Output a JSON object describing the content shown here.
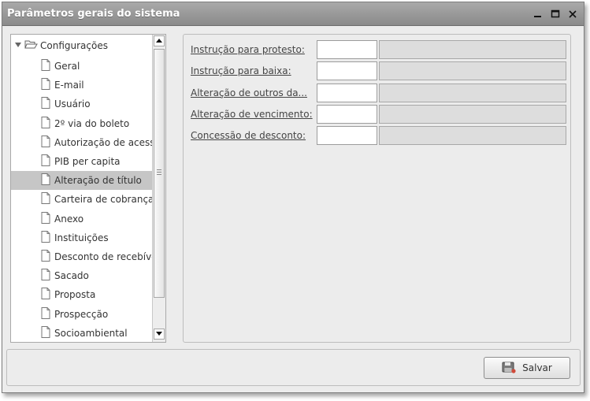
{
  "window": {
    "title": "Parâmetros gerais do sistema",
    "controls": [
      "minimize-icon",
      "maximize-icon",
      "close-icon"
    ]
  },
  "tree": {
    "root_label": "Configurações",
    "selected_index": 6,
    "items": [
      {
        "label": "Geral"
      },
      {
        "label": "E-mail"
      },
      {
        "label": "Usuário"
      },
      {
        "label": "2º via do boleto"
      },
      {
        "label": "Autorização de acesso"
      },
      {
        "label": "PIB per capita"
      },
      {
        "label": "Alteração de título"
      },
      {
        "label": "Carteira de cobrança"
      },
      {
        "label": "Anexo"
      },
      {
        "label": "Instituições"
      },
      {
        "label": "Desconto de recebíveis"
      },
      {
        "label": "Sacado"
      },
      {
        "label": "Proposta"
      },
      {
        "label": "Prospecção"
      },
      {
        "label": "Socioambiental"
      }
    ]
  },
  "form": {
    "rows": [
      {
        "label": "Instrução para protesto:",
        "code": "",
        "description": ""
      },
      {
        "label": "Instrução para baixa:",
        "code": "",
        "description": ""
      },
      {
        "label": "Alteração de outros da...",
        "code": "",
        "description": ""
      },
      {
        "label": "Alteração de vencimento:",
        "code": "",
        "description": ""
      },
      {
        "label": "Concessão de desconto:",
        "code": "",
        "description": ""
      }
    ]
  },
  "footer": {
    "save_label": "Salvar"
  },
  "colors": {
    "titlebar": "#999999",
    "selected_row": "#c6c6c6",
    "panel_bg": "#ececec"
  }
}
